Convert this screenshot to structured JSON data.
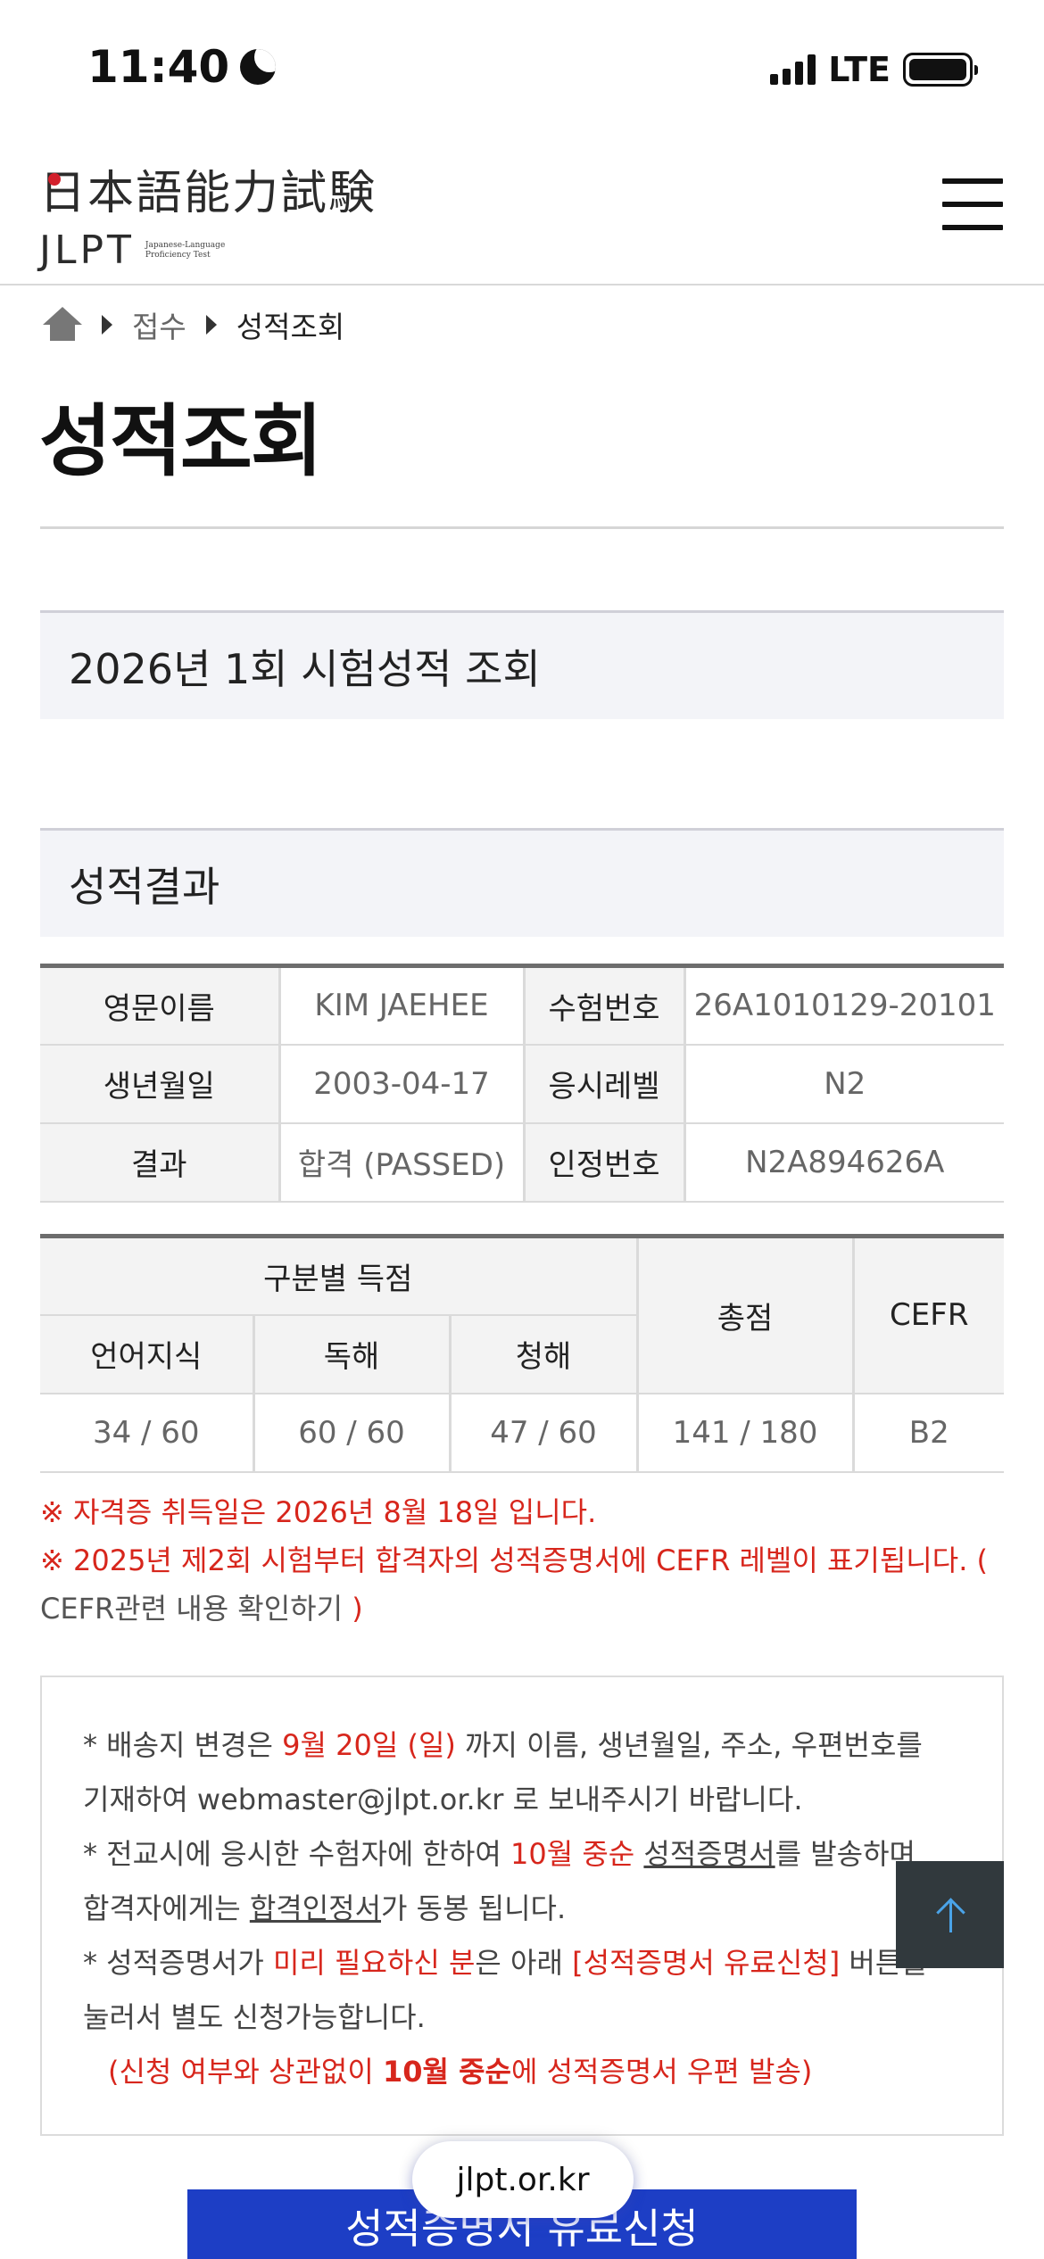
{
  "status_bar": {
    "time": "11:40",
    "network": "LTE"
  },
  "header": {
    "logo_kanji": "日本語能力試験",
    "logo_latin": "JLPT",
    "logo_subtitle": "Japanese-Language Proficiency Test"
  },
  "breadcrumb": {
    "items": [
      "접수",
      "성적조회"
    ]
  },
  "page_title": "성적조회",
  "exam_section": {
    "title": "2026년 1회 시험성적 조회"
  },
  "result_section": {
    "title": "성적결과"
  },
  "info_table": {
    "rows": [
      {
        "label1": "영문이름",
        "value1": "KIM JAEHEE",
        "label2": "수험번호",
        "value2": "26A1010129-20101"
      },
      {
        "label1": "생년월일",
        "value1": "2003-04-17",
        "label2": "응시레벨",
        "value2": "N2"
      },
      {
        "label1": "결과",
        "value1": "합격 (PASSED)",
        "label2": "인정번호",
        "value2": "N2A894626A"
      }
    ]
  },
  "score_table": {
    "group_header": "구분별 득점",
    "sub_headers": [
      "언어지식",
      "독해",
      "청해"
    ],
    "total_header": "총점",
    "cefr_header": "CEFR",
    "values": [
      "34 / 60",
      "60 / 60",
      "47 / 60"
    ],
    "total": "141 / 180",
    "cefr": "B2"
  },
  "notices": {
    "line1": "※ 자격증 취득일은 2026년 8월 18일 입니다.",
    "line2": "※ 2025년 제2회 시험부터 합격자의 성적증명서에 CEFR 레벨이 표기됩니다. (",
    "line3_link": "CEFR관련 내용 확인하기",
    "line3_close": ")"
  },
  "info_box": {
    "p1a": "* 배송지 변경은 ",
    "p1b": "9월 20일 (일)",
    "p1c": " 까지 이름, 생년월일, 주소, 우편번호를",
    "p2": "기재하여 webmaster@jlpt.or.kr 로 보내주시기 바랍니다.",
    "p3a": "* 전교시에 응시한 수험자에 한하여 ",
    "p3b": "10월 중순",
    "p3c": " ",
    "p3d": "성적증명서",
    "p3e": "를 발송하며",
    "p4a": "합격자에게는 ",
    "p4b": "합격인정서",
    "p4c": "가 동봉 됩니다.",
    "p5a": "* 성적증명서가 ",
    "p5b": "미리 필요하신 분",
    "p5c": "은 아래 ",
    "p5d": "[성적증명서 유료신청]",
    "p5e": " 버튼을",
    "p6": "눌러서 별도 신청가능합니다.",
    "p7a": "(신청 여부와 상관없이 ",
    "p7b": "10월 중순",
    "p7c": "에 성적증명서 우편 발송)"
  },
  "cert_button_label": "성적증명서 유료신청",
  "url_bar": "jlpt.or.kr"
}
